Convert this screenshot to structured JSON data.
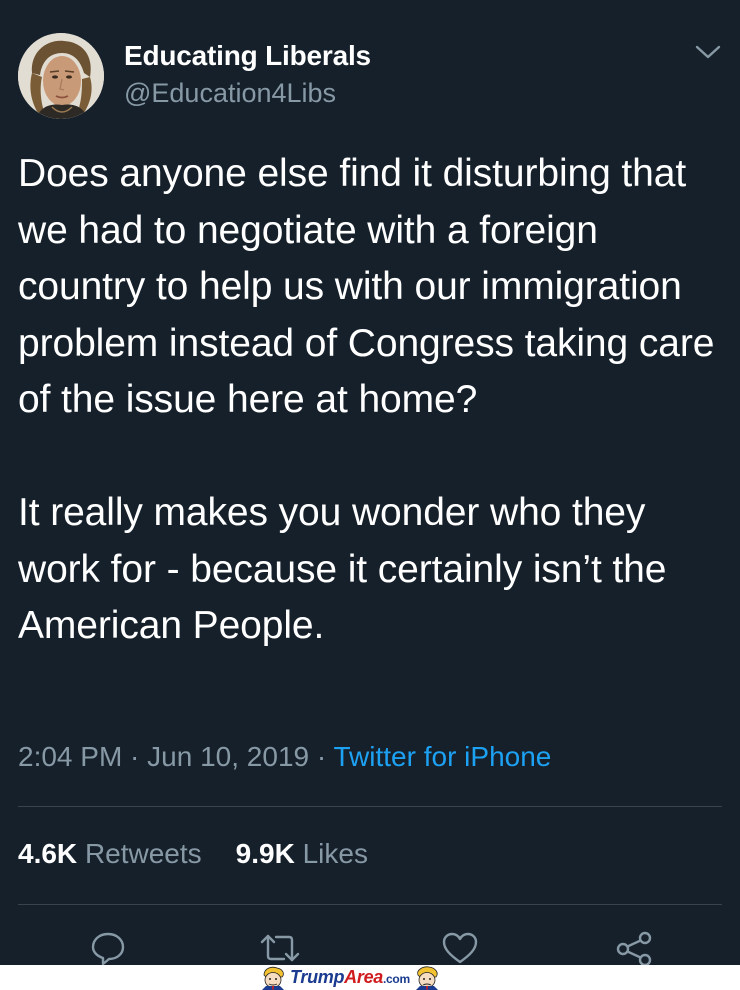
{
  "tweet": {
    "display_name": "Educating Liberals",
    "handle": "@Education4Libs",
    "text": "Does anyone else find it disturbing that we had to negotiate with a foreign country to help us with our immigration problem instead of Congress taking care of the issue here at home?\n\nIt really makes you wonder who they work for - because it certainly isn’t the American People.",
    "time": "2:04 PM",
    "separator": " · ",
    "date": "Jun 10, 2019",
    "source": "Twitter for iPhone"
  },
  "stats": {
    "retweets_count": "4.6K",
    "retweets_label": "Retweets",
    "likes_count": "9.9K",
    "likes_label": "Likes"
  },
  "actions": [
    {
      "icon": "reply-icon"
    },
    {
      "icon": "retweet-icon"
    },
    {
      "icon": "like-icon"
    },
    {
      "icon": "share-icon"
    }
  ],
  "watermark": {
    "part1": "Trump",
    "part2": "Area",
    "part3": ".com"
  },
  "colors": {
    "background": "#15202b",
    "text": "#ffffff",
    "secondary": "#8899a6",
    "link": "#1da1f2",
    "divider": "#38444d"
  }
}
